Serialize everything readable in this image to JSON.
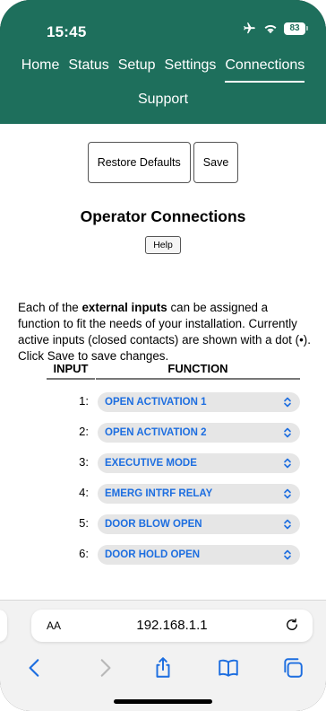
{
  "status_bar": {
    "time": "15:45",
    "battery": "83"
  },
  "nav": {
    "items": [
      "Home",
      "Status",
      "Setup",
      "Settings",
      "Connections"
    ],
    "active": "Connections",
    "second_row": "Support"
  },
  "buttons": {
    "restore": "Restore Defaults",
    "save": "Save",
    "help": "Help"
  },
  "page_title": "Operator Connections",
  "intro": {
    "before": "Each of the ",
    "bold": "external inputs",
    "after": " can be assigned a function to fit the needs of your installation. Currently active inputs (closed contacts) are shown with a dot (•). Click Save to save changes."
  },
  "table": {
    "headers": {
      "input": "INPUT",
      "function": "FUNCTION"
    },
    "rows": [
      {
        "input": "1:",
        "function": "OPEN ACTIVATION 1"
      },
      {
        "input": "2:",
        "function": "OPEN ACTIVATION 2"
      },
      {
        "input": "3:",
        "function": "EXECUTIVE MODE"
      },
      {
        "input": "4:",
        "function": "EMERG INTRF RELAY"
      },
      {
        "input": "5:",
        "function": "DOOR BLOW OPEN"
      },
      {
        "input": "6:",
        "function": "DOOR HOLD OPEN"
      }
    ]
  },
  "browser": {
    "text_size_label": "AA",
    "url": "192.168.1.1",
    "icons": [
      "back-icon",
      "forward-icon",
      "share-icon",
      "bookmarks-icon",
      "tabs-icon",
      "reload-icon",
      "airplane-icon",
      "wifi-icon",
      "battery-icon"
    ]
  },
  "colors": {
    "header_bg": "#1e6f5c",
    "select_text": "#1d6ee0",
    "select_bg": "#e6e6e6"
  }
}
